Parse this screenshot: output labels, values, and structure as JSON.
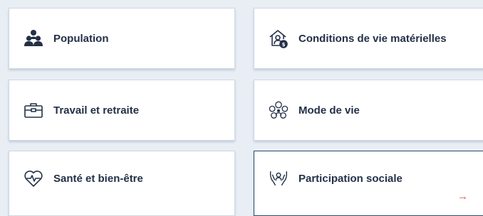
{
  "tiles": [
    {
      "label": "Population",
      "icon": "population-icon"
    },
    {
      "label": "Conditions de vie matérielles",
      "icon": "house-money-icon"
    },
    {
      "label": "Travail et retraite",
      "icon": "briefcase-icon"
    },
    {
      "label": "Mode de vie",
      "icon": "social-network-icon"
    },
    {
      "label": "Santé et bien-être",
      "icon": "heart-pulse-icon"
    },
    {
      "label": "Participation sociale",
      "icon": "hands-person-icon",
      "arrow": "→"
    }
  ],
  "colors": {
    "background": "#e9eef5",
    "text": "#243047",
    "accent_arrow": "#e1573d"
  }
}
